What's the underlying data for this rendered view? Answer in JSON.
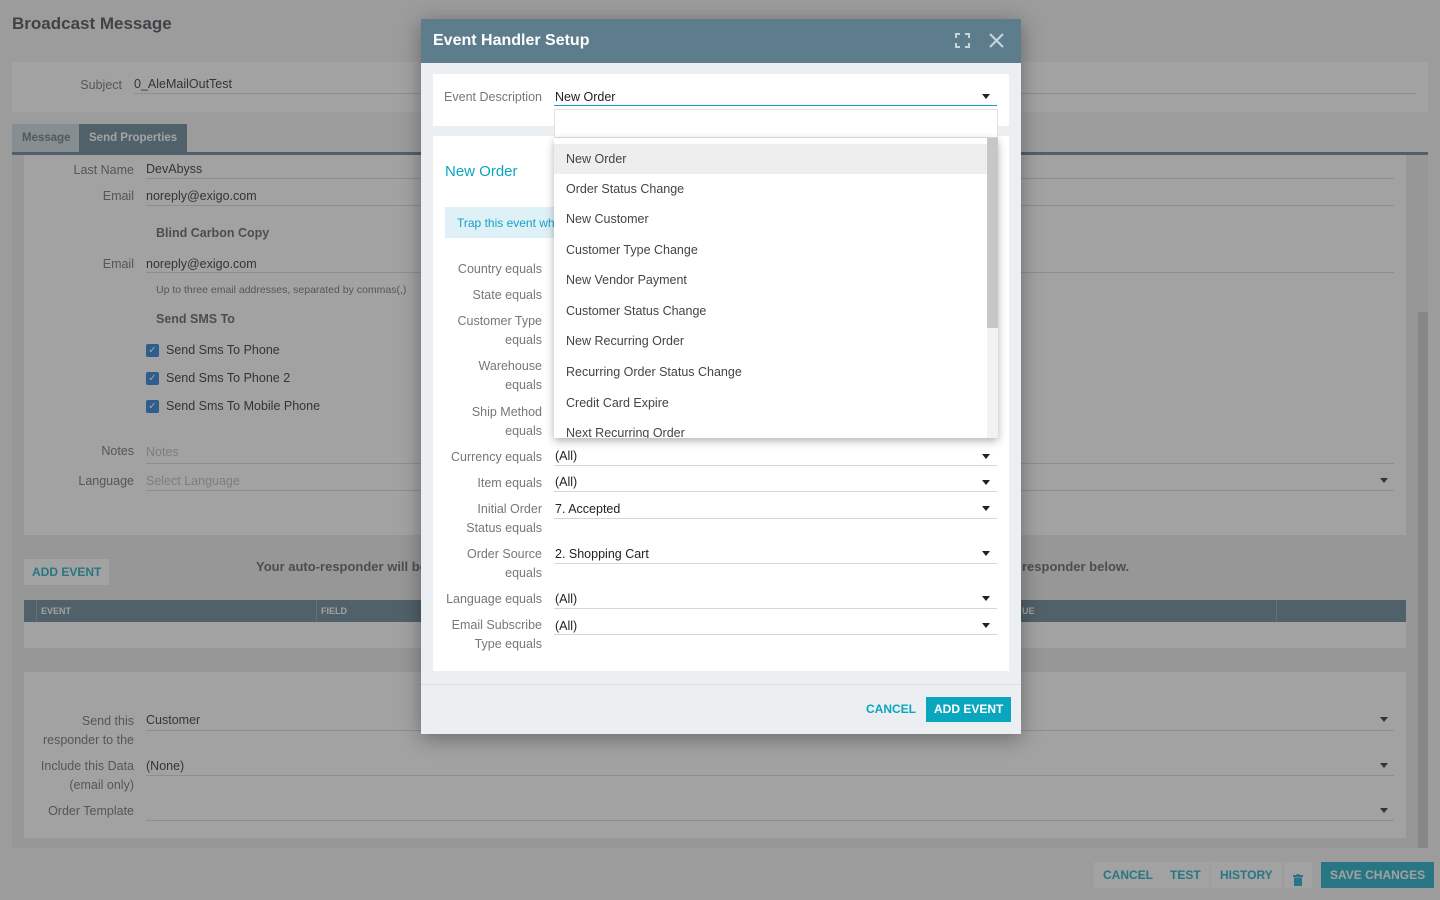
{
  "page": {
    "title": "Broadcast Message",
    "subject_label": "Subject",
    "subject_value": "0_AleMailOutTest",
    "tabs": [
      "Message",
      "Send Properties"
    ],
    "last_name_label": "Last Name",
    "last_name_value": "DevAbyss",
    "email_label": "Email",
    "email_value": "noreply@exigo.com",
    "bcc_heading": "Blind Carbon Copy",
    "bcc_email_label": "Email",
    "bcc_email_value": "noreply@exigo.com",
    "bcc_hint": "Up to three email addresses, separated by commas(,)",
    "sms_heading": "Send SMS To",
    "sms_checks": [
      "Send Sms To Phone",
      "Send Sms To Phone 2",
      "Send Sms To Mobile Phone"
    ],
    "notes_label": "Notes",
    "notes_placeholder": "Notes",
    "language_label": "Language",
    "language_placeholder": "Select Language",
    "add_event_button": "ADD EVENT",
    "autoresponder_text_left": "Your auto-responder will be s",
    "autoresponder_text_right": "responder below.",
    "grid_columns": [
      "EVENT",
      "FIELD",
      "UE"
    ],
    "send_this_label": "Send this responder to the",
    "send_this_value": "Customer",
    "include_data_label": "Include this Data (email only)",
    "include_data_value": "(None)",
    "order_template_label": "Order Template",
    "order_template_value": "",
    "footer": {
      "cancel": "CANCEL",
      "test": "TEST",
      "history": "HISTORY",
      "delete_icon": "trash-icon",
      "save": "SAVE CHANGES"
    }
  },
  "dialog": {
    "title": "Event Handler Setup",
    "expand_icon": "expand-icon",
    "close_icon": "close-icon",
    "event_description_label": "Event Description",
    "event_description_value": "New Order",
    "section_title": "New Order",
    "info_text": "Trap this event wh",
    "filters": [
      {
        "label": "Country equals",
        "value": ""
      },
      {
        "label": "State equals",
        "value": ""
      },
      {
        "label": "Customer Type equals",
        "value": ""
      },
      {
        "label": "Warehouse equals",
        "value": ""
      },
      {
        "label": "Ship Method equals",
        "value": ""
      },
      {
        "label": "Currency equals",
        "value": "(All)"
      },
      {
        "label": "Item equals",
        "value": "(All)"
      },
      {
        "label": "Initial Order Status equals",
        "value": "7. Accepted"
      },
      {
        "label": "Order Source equals",
        "value": "2. Shopping Cart"
      },
      {
        "label": "Language equals",
        "value": "(All)"
      },
      {
        "label": "Email Subscribe Type equals",
        "value": "(All)"
      }
    ],
    "cancel_button": "CANCEL",
    "add_event_button": "ADD EVENT"
  },
  "dropdown": {
    "search_value": "",
    "options": [
      "New Order",
      "Order Status Change",
      "New Customer",
      "Customer Type Change",
      "New Vendor Payment",
      "Customer Status Change",
      "New Recurring Order",
      "Recurring Order Status Change",
      "Credit Card Expire",
      "Next Recurring Order"
    ],
    "selected": "New Order"
  },
  "colors": {
    "header": "#5d7d8d",
    "accent": "#0aa6c0",
    "checkbox": "#1976d2"
  }
}
